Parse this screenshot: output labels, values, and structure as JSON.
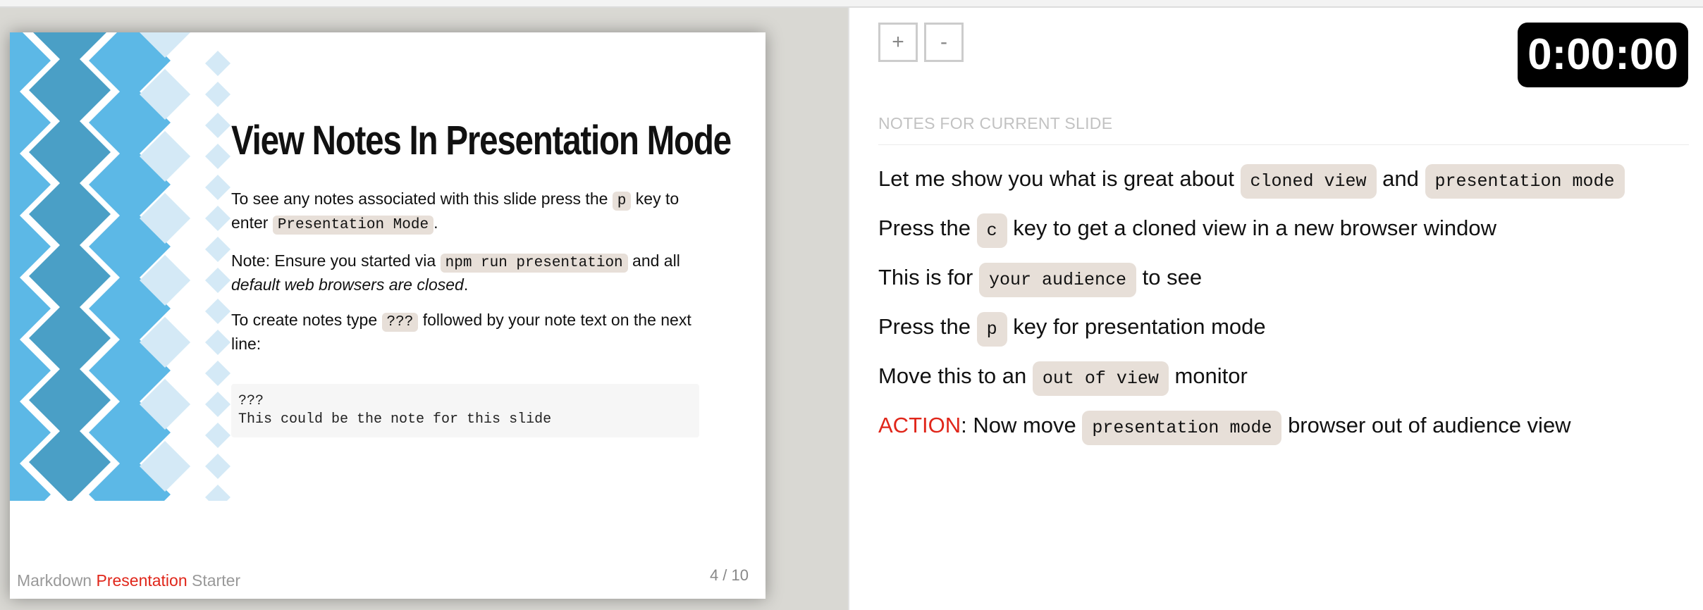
{
  "slide": {
    "title": "View Notes In Presentation Mode",
    "p1": {
      "a": "To see any notes associated with this slide press the ",
      "code1": "p",
      "b": " key to enter ",
      "code2": "Presentation Mode",
      "c": "."
    },
    "p2": {
      "a": "Note: Ensure you started via ",
      "code1": "npm run presentation",
      "b": " and all ",
      "em": "default web browsers are closed",
      "c": "."
    },
    "p3": {
      "a": "To create notes type ",
      "code1": "???",
      "b": " followed by your note text on the next line:"
    },
    "code_block": "???\nThis could be the note for this slide",
    "footer": {
      "part1": "Markdown ",
      "part2": "Presentation",
      "part3": " Starter"
    },
    "page_number": "4 / 10"
  },
  "controls": {
    "zoom_in_label": "+",
    "zoom_out_label": "-",
    "timer": "0:00:00"
  },
  "notes": {
    "heading": "NOTES FOR CURRENT SLIDE",
    "lines": [
      {
        "a": "Let me show you what is great about ",
        "code1": "cloned view",
        "b": " and ",
        "code2": "presentation mode"
      },
      {
        "a": "Press the ",
        "code1": "c",
        "b": " key to get a cloned view in a new browser window"
      },
      {
        "a": "This is for ",
        "code1": "your audience",
        "b": " to see"
      },
      {
        "a": "Press the ",
        "code1": "p",
        "b": " key for presentation mode"
      },
      {
        "a": "Move this to an ",
        "code1": "out of view",
        "b": " monitor"
      },
      {
        "action": "ACTION",
        "a": ": Now move ",
        "code1": "presentation mode",
        "b": " browser out of audience view"
      }
    ]
  },
  "colors": {
    "accent_red": "#e0261a",
    "code_bg": "#e7dfd8",
    "diamond_dark": "#4a9fc6",
    "diamond_mid": "#5cb8e6",
    "diamond_light": "#d4e9f6"
  }
}
